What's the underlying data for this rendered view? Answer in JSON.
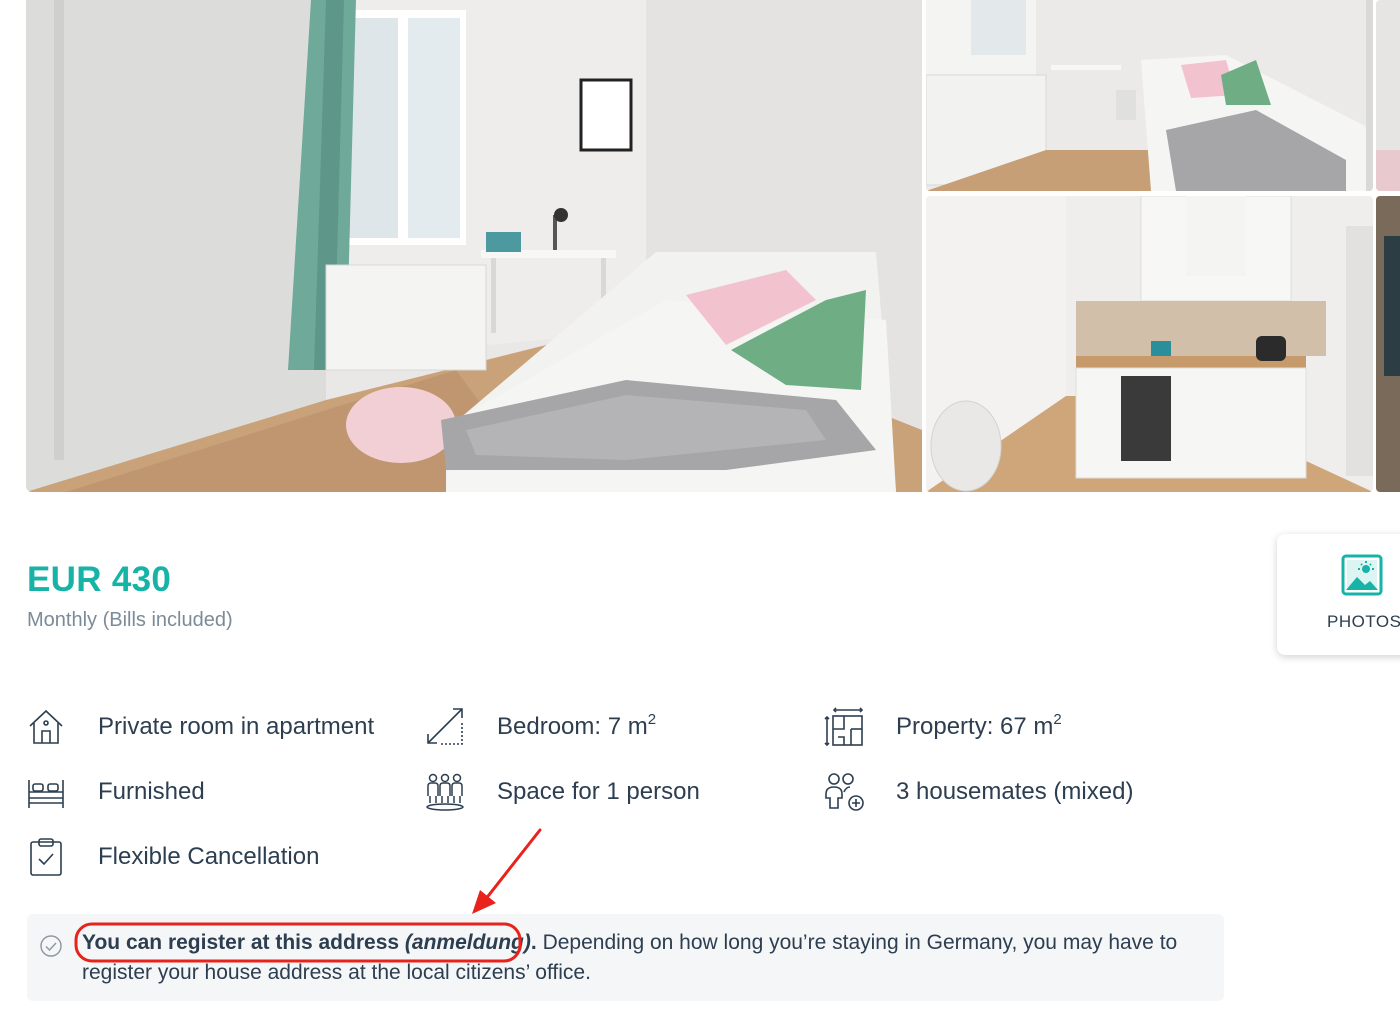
{
  "listing": {
    "price": "EUR 430",
    "price_subtitle": "Monthly (Bills included)",
    "photos_button_label": "PHOTOS",
    "accent_color": "#16b3a6"
  },
  "features": [
    {
      "icon": "house-icon",
      "label": "Private room in apartment"
    },
    {
      "icon": "area-icon",
      "label": "Bedroom: 7 m",
      "unit_sup": "2"
    },
    {
      "icon": "floorplan-icon",
      "label": "Property: 67 m",
      "unit_sup": "2"
    },
    {
      "icon": "bed-icon",
      "label": "Furnished"
    },
    {
      "icon": "people-group-icon",
      "label": "Space for 1 person"
    },
    {
      "icon": "housemates-icon",
      "label": "3 housemates (mixed)"
    },
    {
      "icon": "clipboard-check-icon",
      "label": "Flexible Cancellation"
    }
  ],
  "notice": {
    "bold_text": "You can register at this address ",
    "italic_text": "(anmeldung)",
    "bold_end": ".",
    "body_text": " Depending on how long you’re staying in Germany, you may have to register your house address at the local citizens’ office."
  },
  "annotation_color": "#e8231c"
}
